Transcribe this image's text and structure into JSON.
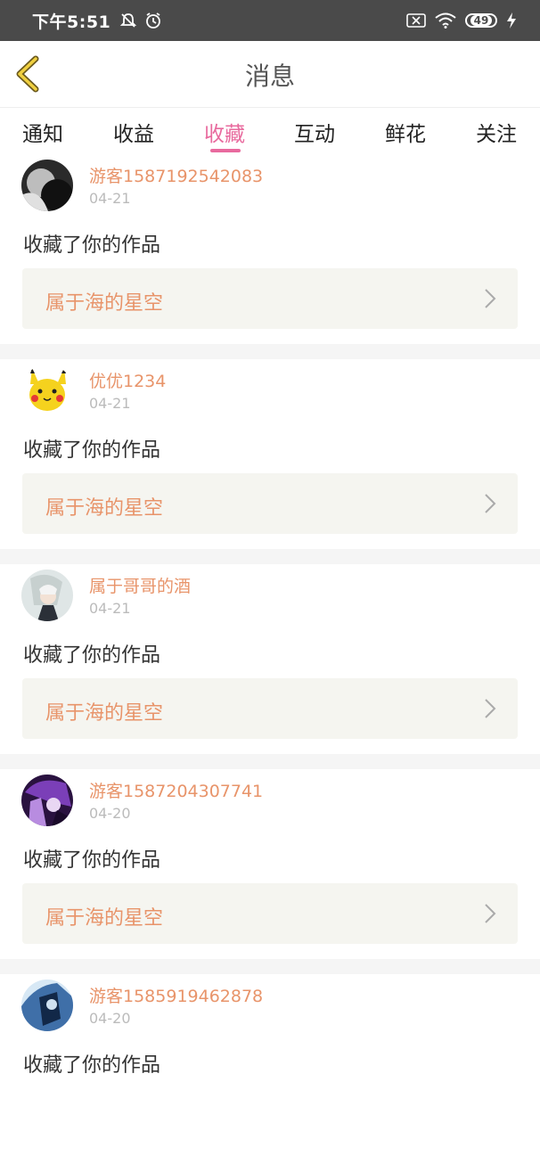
{
  "status_bar": {
    "time": "下午5:51",
    "battery": "49",
    "icons": [
      "mute-icon",
      "alarm-icon",
      "sim-off-icon",
      "wifi-icon",
      "battery-icon",
      "charging-icon"
    ]
  },
  "header": {
    "title": "消息",
    "back_icon": "chevron-left-icon"
  },
  "tabs": [
    {
      "label": "通知",
      "active": false
    },
    {
      "label": "收益",
      "active": false
    },
    {
      "label": "收藏",
      "active": true
    },
    {
      "label": "互动",
      "active": false
    },
    {
      "label": "鲜花",
      "active": false
    },
    {
      "label": "关注",
      "active": false
    }
  ],
  "colors": {
    "accent": "#e86a9e",
    "username": "#e8946a",
    "work_title": "#e8946a",
    "status_bar": "#4a4a4a"
  },
  "items": [
    {
      "username": "游客1587192542083",
      "date": "04-21",
      "action": "收藏了你的作品",
      "work": "属于海的星空",
      "avatar": "dark-photo-avatar"
    },
    {
      "username": "优优1234",
      "date": "04-21",
      "action": "收藏了你的作品",
      "work": "属于海的星空",
      "avatar": "pikachu-avatar"
    },
    {
      "username": "属于哥哥的酒",
      "date": "04-21",
      "action": "收藏了你的作品",
      "work": "属于海的星空",
      "avatar": "anime-character-avatar"
    },
    {
      "username": "游客1587204307741",
      "date": "04-20",
      "action": "收藏了你的作品",
      "work": "属于海的星空",
      "avatar": "purple-anime-avatar"
    },
    {
      "username": "游客1585919462878",
      "date": "04-20",
      "action": "收藏了你的作品",
      "work": "",
      "avatar": "blue-anime-avatar"
    }
  ]
}
